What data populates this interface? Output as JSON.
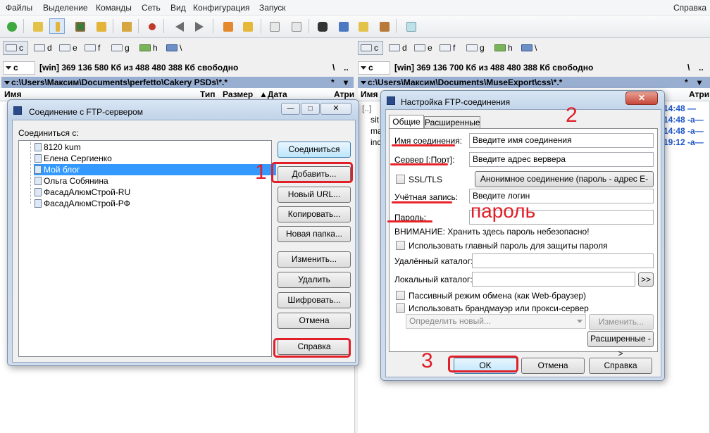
{
  "menu": [
    "Файлы",
    "Выделение",
    "Команды",
    "Сеть",
    "Вид",
    "Конфигурация",
    "Запуск"
  ],
  "menu_help": "Справка",
  "drives_left": [
    "c",
    "d",
    "e",
    "f",
    "g",
    "h",
    "\\"
  ],
  "drives_right": [
    "c",
    "d",
    "e",
    "f",
    "g",
    "h",
    "\\"
  ],
  "left_panel": {
    "drive": "c",
    "info": "[win]  369 136 580 Кб из 488 480 388 Кб свободно",
    "root": "\\",
    "up": "..",
    "path": "c:\\Users\\Максим\\Documents\\perfetto\\Cakery PSDs\\*.*",
    "filter": "*",
    "filter_arrow": "▾",
    "columns": [
      "Имя",
      "Тип",
      "Размер",
      "Дата",
      "Атри"
    ]
  },
  "right_panel": {
    "drive": "c",
    "info": "[win]  369 136 700 Кб из 488 480 388 Кб свободно",
    "root": "\\",
    "up": "..",
    "path": "c:\\Users\\Максим\\Documents\\MuseExport\\css\\*.*",
    "filter": "*",
    "filter_arrow": "▾",
    "columns": [
      "Имя",
      "Атри"
    ],
    "partial_names": [
      "[..]",
      "sit",
      "ma",
      "ind"
    ],
    "times": [
      "14:48 —",
      "14:48 -a—",
      "14:48 -a—",
      "19:12 -a—"
    ]
  },
  "ftp_dialog": {
    "title": "Соединение с FTP-сервером",
    "connect_label": "Соединиться с:",
    "items": [
      "8120 kum",
      "Елена Сергиенко",
      "Мой блог",
      "Ольга Собянина",
      "ФасадАлюмСтрой-RU",
      "ФасадАлюмСтрой-РФ"
    ],
    "selected_item": "Мой блог",
    "buttons": {
      "connect": "Соединиться",
      "add": "Добавить...",
      "new_url": "Новый URL...",
      "copy": "Копировать...",
      "new_folder": "Новая папка...",
      "edit": "Изменить...",
      "delete": "Удалить",
      "encrypt": "Шифровать...",
      "cancel": "Отмена",
      "help": "Справка"
    },
    "window_controls": [
      "—",
      "□",
      "✕"
    ]
  },
  "settings_dialog": {
    "title": "Настройка FTP-соединения",
    "tabs": [
      "Общие",
      "Расширенные"
    ],
    "labels": {
      "name": "Имя соединения:",
      "server": "Сервер [:Порт]:",
      "ssl": "SSL/TLS",
      "account": "Учётная запись:",
      "password": "Пароль:",
      "warning": "ВНИМАНИЕ: Хранить здесь пароль небезопасно!",
      "master_pw": "Использовать главный пароль для защиты пароля",
      "remote_dir": "Удалённый каталог:",
      "local_dir": "Локальный каталог:",
      "passive": "Пассивный режим обмена (как Web-браузер)",
      "firewall": "Использовать брандмауэр или прокси-сервер"
    },
    "values": {
      "name": "Введите имя соединения",
      "server": "Введите адрес вервера",
      "account": "Введите логин",
      "password": "",
      "remote_dir": "",
      "local_dir": "",
      "proxy": "Определить новый..."
    },
    "buttons": {
      "anon": "Анонимное соединение (пароль - адрес E-mail)",
      "browse": ">>",
      "edit": "Изменить...",
      "advanced": "Расширенные ->",
      "ok": "OK",
      "cancel": "Отмена",
      "help": "Справка"
    },
    "close": "✕"
  },
  "annotations": {
    "step1": "1",
    "step2": "2",
    "step3": "3",
    "password_note": "пароль"
  },
  "colors": {
    "annotation_red": "#e01f28",
    "path_bar": "#99afd2",
    "selection": "#3399ff"
  }
}
